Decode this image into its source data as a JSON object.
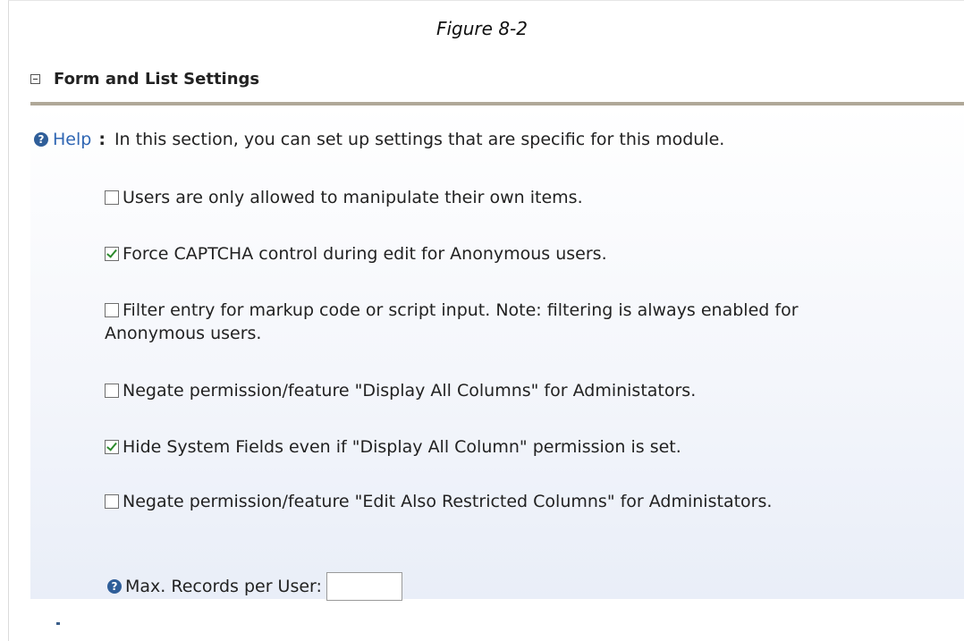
{
  "caption": "Figure 8-2",
  "section": {
    "title": "Form and List Settings",
    "toggle_icon": "collapse-minus-icon"
  },
  "help": {
    "link_label": "Help",
    "separator": ":",
    "text": "In this section, you can set up settings that are specific for this module."
  },
  "options": [
    {
      "label": "Users are only allowed to manipulate their own items.",
      "checked": false
    },
    {
      "label": "Force CAPTCHA control during edit for Anonymous users.",
      "checked": true
    },
    {
      "label": "Filter entry for markup code or script input. Note: filtering is always enabled for Anonymous users.",
      "checked": false
    },
    {
      "label": "Negate permission/feature \"Display All Columns\" for Administators.",
      "checked": false
    },
    {
      "label": "Hide System Fields even if \"Display All Column\" permission is set.",
      "checked": true
    },
    {
      "label": "Negate permission/feature \"Edit Also Restricted Columns\" for Administators.",
      "checked": false
    }
  ],
  "max_records": {
    "label": "Max. Records per User:",
    "value": ""
  },
  "colors": {
    "link": "#2f66b3",
    "checkmark": "#2c8a2c",
    "header_rule": "#b0a898"
  }
}
